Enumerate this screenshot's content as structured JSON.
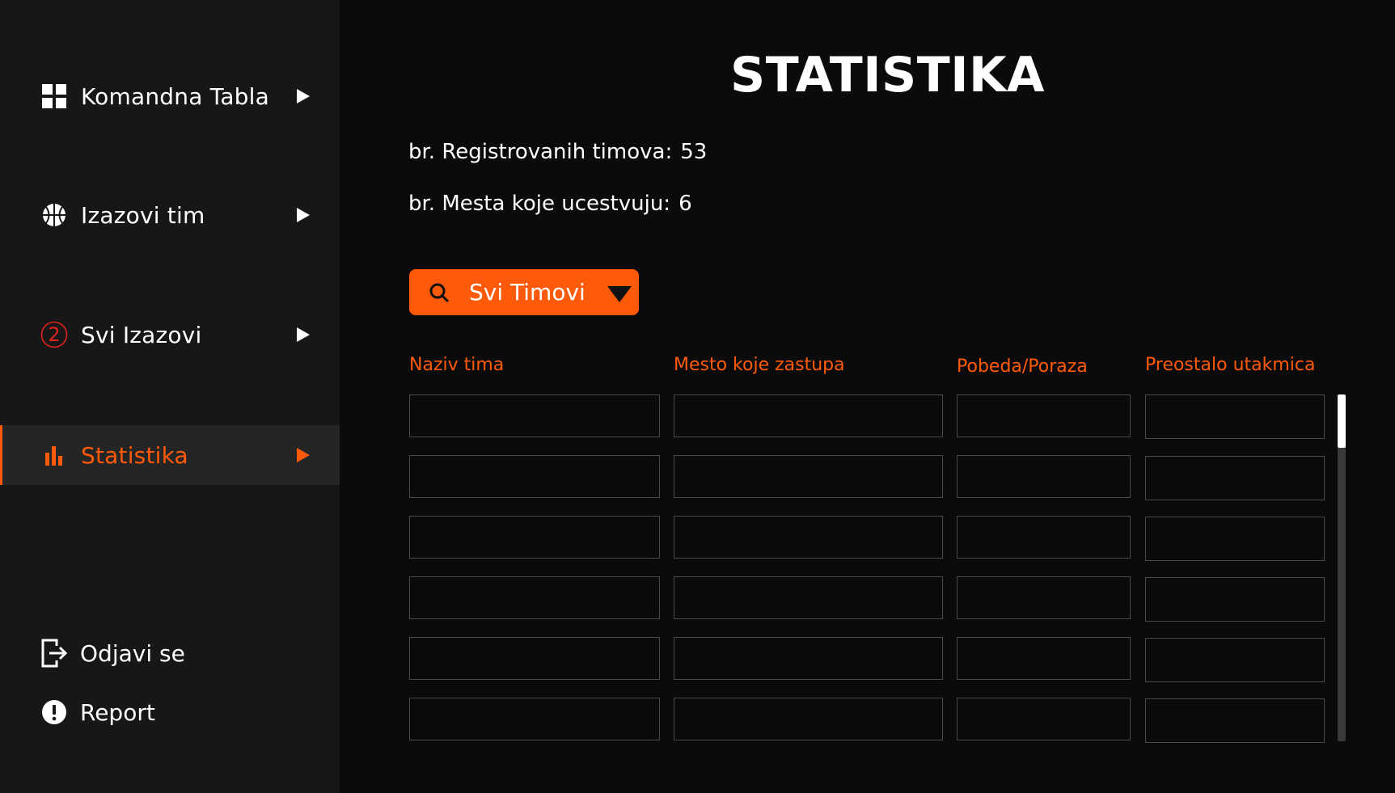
{
  "sidebar": {
    "items": [
      {
        "label": "Komandna Tabla",
        "icon": "dashboard-icon"
      },
      {
        "label": "Izazovi tim",
        "icon": "basketball-icon"
      },
      {
        "label": "Svi Izazovi",
        "icon": "number-2-icon",
        "badge": "2"
      },
      {
        "label": "Statistika",
        "icon": "bar-chart-icon"
      }
    ],
    "active_index": 3,
    "bottom": [
      {
        "label": "Odjavi se",
        "icon": "logout-icon"
      },
      {
        "label": "Report",
        "icon": "alert-icon"
      }
    ]
  },
  "main": {
    "title": "STATISTIKA",
    "stats": [
      {
        "label": "br. Registrovanih timova:",
        "value": "53"
      },
      {
        "label": "br. Mesta koje ucestvuju:",
        "value": "6"
      }
    ],
    "filter": {
      "selected": "Svi Timovi"
    },
    "table": {
      "columns": [
        "Naziv tima",
        "Mesto koje zastupa",
        "Pobeda/Poraza",
        "Preostalo utakmica"
      ],
      "rows": [
        [
          "",
          "",
          "",
          ""
        ],
        [
          "",
          "",
          "",
          ""
        ],
        [
          "",
          "",
          "",
          ""
        ],
        [
          "",
          "",
          "",
          ""
        ],
        [
          "",
          "",
          "",
          ""
        ],
        [
          "",
          "",
          "",
          ""
        ]
      ]
    }
  },
  "colors": {
    "accent": "#ff5a0a",
    "sidebar_bg": "#171717",
    "main_bg": "#0b0b0c",
    "active_item_bg": "#252525",
    "text": "#ffffff",
    "cell_border": "#4a4a4a"
  }
}
